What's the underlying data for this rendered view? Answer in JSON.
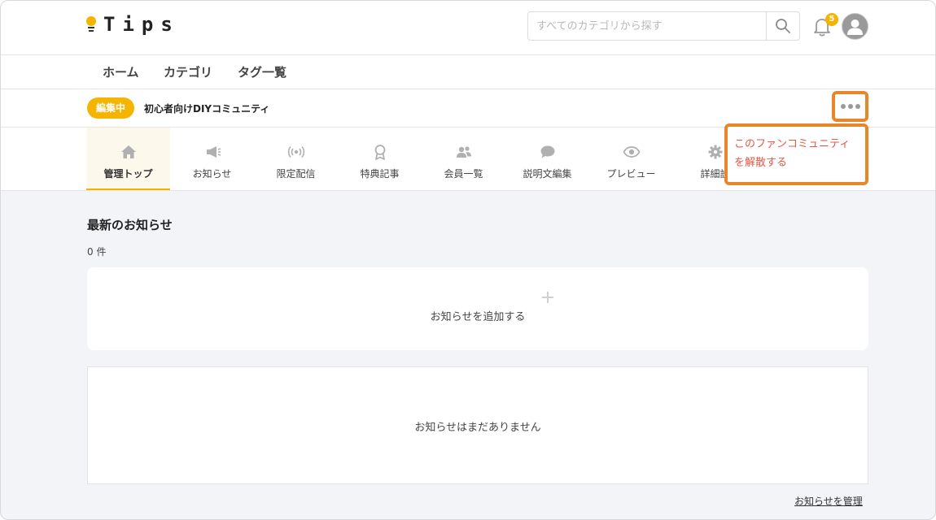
{
  "header": {
    "logo_text": "Tips",
    "search_placeholder": "すべてのカテゴリから探す",
    "notification_count": "5"
  },
  "nav": {
    "items": [
      {
        "label": "ホーム"
      },
      {
        "label": "カテゴリ"
      },
      {
        "label": "タグ一覧"
      }
    ]
  },
  "status": {
    "edit_badge": "編集中",
    "community_name": "初心者向けDIYコミュニティ"
  },
  "tabs": [
    {
      "label": "管理トップ",
      "icon": "home-icon",
      "active": true
    },
    {
      "label": "お知らせ",
      "icon": "megaphone-icon"
    },
    {
      "label": "限定配信",
      "icon": "broadcast-icon"
    },
    {
      "label": "特典記事",
      "icon": "award-icon"
    },
    {
      "label": "会員一覧",
      "icon": "users-icon"
    },
    {
      "label": "説明文編集",
      "icon": "speech-bubble-icon"
    },
    {
      "label": "プレビュー",
      "icon": "eye-icon"
    },
    {
      "label": "詳細設",
      "icon": "gear-icon"
    }
  ],
  "dropdown": {
    "line1": "このファンコミュニティ",
    "line2": "を解散する"
  },
  "main": {
    "section_title": "最新のお知らせ",
    "count": "0 件",
    "add_label": "お知らせを追加する",
    "empty_message": "お知らせはまだありません",
    "manage_link": "お知らせを管理"
  },
  "colors": {
    "accent": "#f5b400",
    "highlight": "#e8862a",
    "danger_text": "#e05a4a",
    "background": "#f3f4f8"
  }
}
